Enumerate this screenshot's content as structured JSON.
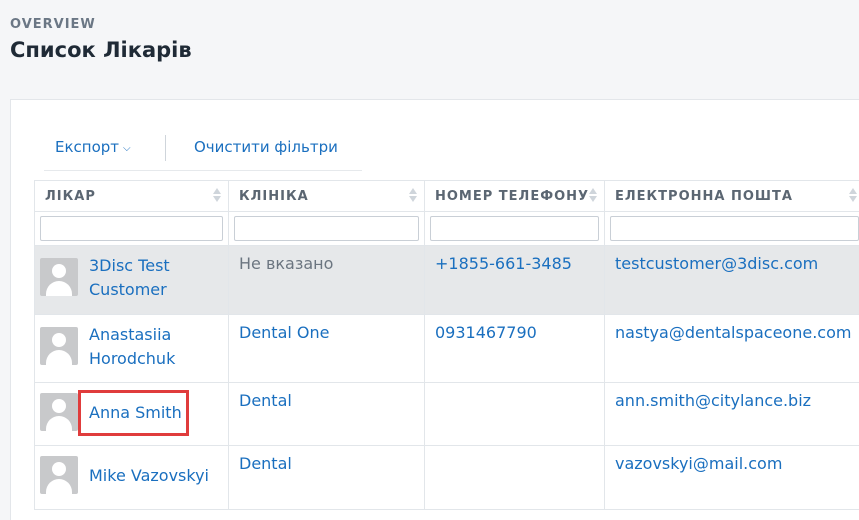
{
  "header": {
    "overview": "OVERVIEW",
    "title": "Список Лікарів"
  },
  "toolbar": {
    "export_label": "Експорт",
    "export_chevron": "⌵",
    "clear_filters_label": "Очистити фільтри"
  },
  "table": {
    "columns": [
      "ЛІКАР",
      "КЛІНІКА",
      "НОМЕР ТЕЛЕФОНУ",
      "ЕЛЕКТРОННА ПОШТА"
    ],
    "rows": [
      {
        "doctor": "3Disc Test Customer",
        "clinic": "Не вказано",
        "phone": "+1855-661-3485",
        "email": "testcustomer@3disc.com"
      },
      {
        "doctor": "Anastasiia Horodchuk",
        "clinic": "Dental One",
        "phone": "0931467790",
        "email": "nastya@dentalspaceone.com"
      },
      {
        "doctor": "Anna Smith",
        "clinic": "Dental",
        "phone": "",
        "email": "ann.smith@citylance.biz"
      },
      {
        "doctor": "Mike Vazovskyi",
        "clinic": "Dental",
        "phone": "",
        "email": "vazovskyi@mail.com"
      }
    ]
  },
  "colors": {
    "link": "#1a6fbf",
    "highlight_row": "#e6e8ea",
    "annotation_box": "#e03c3c"
  }
}
